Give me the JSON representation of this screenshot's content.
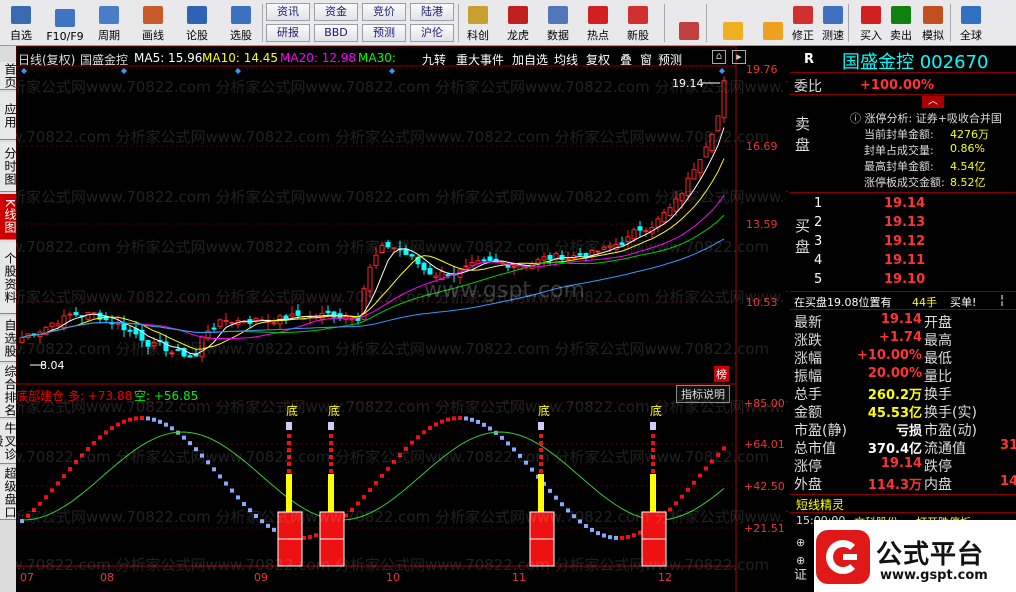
{
  "toolbar": {
    "items": [
      {
        "label": "自选",
        "icon": "home-icon",
        "color": "#3a6ab0"
      },
      {
        "label": "F10/F9",
        "icon": "f10-icon",
        "color": "#3f74c2"
      },
      {
        "label": "周期",
        "icon": "clock-icon",
        "color": "#4a7ec8"
      },
      {
        "label": "画线",
        "icon": "pencil-icon",
        "color": "#c85a2a"
      },
      {
        "label": "论股",
        "icon": "talk-icon",
        "color": "#2e62b2"
      },
      {
        "label": "选股",
        "icon": "target-icon",
        "color": "#3c70c0"
      }
    ],
    "small_buttons": [
      [
        "资讯",
        "研报"
      ],
      [
        "资金",
        "BBD"
      ],
      [
        "竞价",
        "预测"
      ],
      [
        "陆港",
        "沪伦"
      ]
    ],
    "items2": [
      {
        "label": "科创",
        "icon": "chart-icon",
        "color": "#c8a030"
      },
      {
        "label": "龙虎",
        "icon": "dragon-icon",
        "color": "#c02020"
      },
      {
        "label": "数据",
        "icon": "pe-icon",
        "color": "#5078b8"
      },
      {
        "label": "热点",
        "icon": "fire-icon",
        "color": "#d02020"
      },
      {
        "label": "新股",
        "icon": "phone-icon",
        "color": "#d03030"
      }
    ],
    "items3": [
      {
        "label": "",
        "icon": "grid-icon",
        "color": "#c04040"
      },
      {
        "label": "",
        "icon": "back-arrow-icon",
        "color": "#f0b020"
      },
      {
        "label": "",
        "icon": "up-down-icon",
        "color": "#f0a020"
      },
      {
        "label": "修正",
        "icon": "alarm-icon",
        "color": "#d03030"
      },
      {
        "label": "测速",
        "icon": "speed-icon",
        "color": "#4070c0"
      },
      {
        "label": "买入",
        "icon": "buy-icon",
        "color": "#d02020"
      },
      {
        "label": "卖出",
        "icon": "sell-icon",
        "color": "#108010"
      },
      {
        "label": "模拟",
        "icon": "hammer-icon",
        "color": "#c05020"
      },
      {
        "label": "全球",
        "icon": "globe-icon",
        "color": "#3070c0"
      }
    ]
  },
  "left_tabs": [
    "首页",
    "应用",
    "分时图",
    "K线图",
    "个股资料",
    "自选股",
    "综合排名",
    "牛叉诊股",
    "超级盘口"
  ],
  "chart": {
    "header": {
      "period": "日线(复权)",
      "name": "国盛金控",
      "ma5": "MA5: 15.96",
      "ma10": "MA10: 14.45",
      "ma20": "MA20: 12.98",
      "ma30": "MA30:"
    },
    "header_buttons": [
      "九转",
      "重大事件",
      "加自选",
      "均线",
      "复权",
      "叠",
      "窗",
      "预测"
    ],
    "price_labels": [
      "19.76",
      "16.69",
      "13.59",
      "10.53"
    ],
    "high_label": "19.14",
    "low_label": "8.04",
    "rank_badge": "榜",
    "watermark_rows": [
      "分析家公式网www.70822.com 分析家公式网www.70822.com 分析家公式网www.70822.com 分析家公式网www.70822.com"
    ],
    "center_watermark": "www.gspt.com",
    "indicator": {
      "name": "底部建仓",
      "duo": "多: +73.88",
      "kong": "空: +56.85",
      "explain_btn": "指标说明",
      "bottom_mark": "底"
    },
    "ind_labels": [
      "+85.00",
      "+64.01",
      "+42.50",
      "+21.51"
    ],
    "months": [
      "07",
      "08",
      "09",
      "10",
      "11",
      "12"
    ]
  },
  "chart_data": {
    "type": "candlestick",
    "title": "国盛金控",
    "ylim": [
      8.04,
      19.76
    ],
    "high": 19.14,
    "low": 8.04,
    "ma": {
      "MA5": 15.96,
      "MA10": 14.45,
      "MA20": 12.98
    }
  },
  "right": {
    "R": "R",
    "title": "国盛金控 002670",
    "weibi_label": "委比",
    "weibi_val": "+100.00%",
    "zt_title": "涨停分析: 证券+吸收合并国",
    "zt_rows": [
      [
        "当前封单金额:",
        "4276万"
      ],
      [
        "封单占成交量:",
        "0.86%"
      ],
      [
        "最高封单金额:",
        "4.54亿"
      ],
      [
        "涨停板成交金额:",
        "8.52亿"
      ]
    ],
    "sell_label": "卖盘",
    "buy_label": "买盘",
    "buy_rows": [
      [
        "1",
        "19.14"
      ],
      [
        "2",
        "19.13"
      ],
      [
        "3",
        "19.12"
      ],
      [
        "4",
        "19.11"
      ],
      [
        "5",
        "19.10"
      ]
    ],
    "position_line": "在买盘19.08位置有",
    "position_qty": "44手",
    "position_action": "买单!",
    "quote_rows": [
      [
        "最新",
        "19.14",
        "开盘",
        ""
      ],
      [
        "涨跌",
        "+1.74",
        "最高",
        ""
      ],
      [
        "涨幅",
        "+10.00%",
        "最低",
        ""
      ],
      [
        "振幅",
        "20.00%",
        "量比",
        ""
      ],
      [
        "总手",
        "260.2万",
        "换手",
        ""
      ],
      [
        "金额",
        "45.53亿",
        "换手(实)",
        ""
      ],
      [
        "市盈(静)",
        "亏损",
        "市盈(动)",
        ""
      ],
      [
        "总市值",
        "370.4亿",
        "流通值",
        "31"
      ],
      [
        "涨停",
        "19.14",
        "跌停",
        ""
      ],
      [
        "外盘",
        "114.3万",
        "内盘",
        "14"
      ]
    ],
    "duanxian_title": "短线精灵",
    "dx_time": "15:00:00",
    "dx_name": "文科股份",
    "dx_event": "打开跌停板",
    "bottom_char": "证",
    "logo_text": "公式平台",
    "logo_url": "www.gspt.com"
  }
}
